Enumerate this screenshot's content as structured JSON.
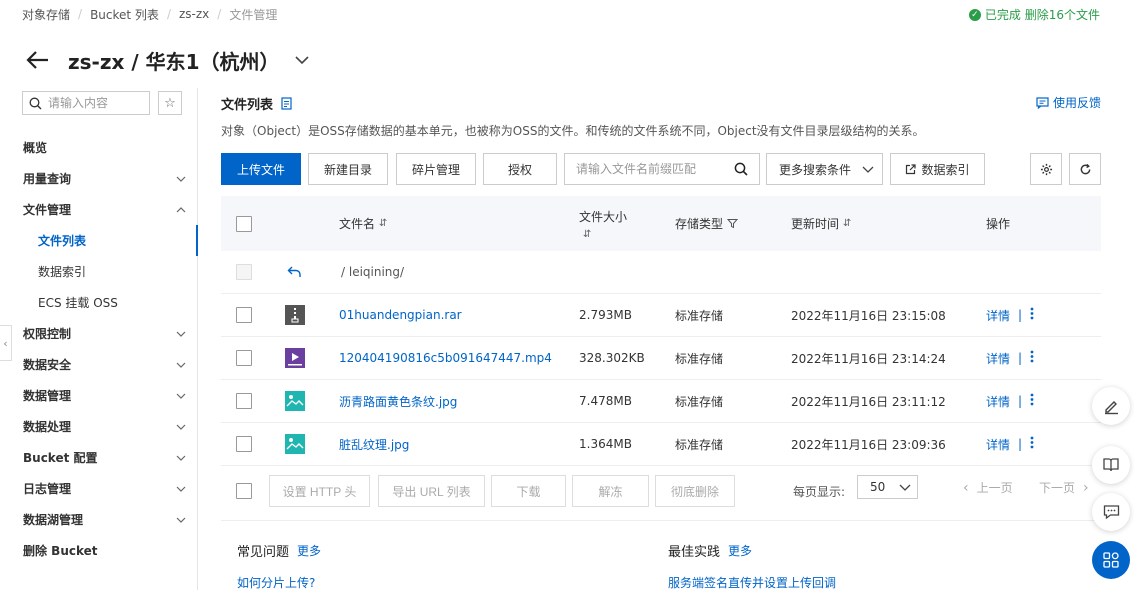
{
  "breadcrumb": [
    "对象存储",
    "Bucket 列表",
    "zs-zx",
    "文件管理"
  ],
  "status_text": "已完成 删除16个文件",
  "bucket_title": "zs-zx / 华东1（杭州）",
  "sidebar": {
    "search_placeholder": "请输入内容",
    "items": [
      {
        "label": "概览",
        "type": "item"
      },
      {
        "label": "用量查询",
        "type": "group",
        "chevron": "down"
      },
      {
        "label": "文件管理",
        "type": "group",
        "chevron": "up"
      },
      {
        "label": "文件列表",
        "type": "sub",
        "active": true
      },
      {
        "label": "数据索引",
        "type": "sub"
      },
      {
        "label": "ECS 挂载 OSS",
        "type": "sub"
      },
      {
        "label": "权限控制",
        "type": "group",
        "chevron": "down"
      },
      {
        "label": "数据安全",
        "type": "group",
        "chevron": "down"
      },
      {
        "label": "数据管理",
        "type": "group",
        "chevron": "down"
      },
      {
        "label": "数据处理",
        "type": "group",
        "chevron": "down"
      },
      {
        "label": "Bucket 配置",
        "type": "group",
        "chevron": "down"
      },
      {
        "label": "日志管理",
        "type": "group",
        "chevron": "down"
      },
      {
        "label": "数据湖管理",
        "type": "group",
        "chevron": "down"
      },
      {
        "label": "删除 Bucket",
        "type": "item"
      }
    ]
  },
  "main": {
    "section_title": "文件列表",
    "feedback": "使用反馈",
    "description": "对象（Object）是OSS存储数据的基本单元，也被称为OSS的文件。和传统的文件系统不同，Object没有文件目录层级结构的关系。",
    "toolbar": {
      "upload": "上传文件",
      "new_dir": "新建目录",
      "fragments": "碎片管理",
      "authorize": "授权",
      "search_placeholder": "请输入文件名前缀匹配",
      "more_search": "更多搜索条件",
      "data_index": "数据索引"
    },
    "table": {
      "headers": {
        "name": "文件名",
        "size": "文件大小",
        "storage": "存储类型",
        "updated": "更新时间",
        "actions": "操作"
      },
      "parent_path": "/  leiqining/",
      "rows": [
        {
          "name": "01huandengpian.rar",
          "size": "2.793MB",
          "storage": "标准存储",
          "updated": "2022年11月16日 23:15:08",
          "icon": "archive-icon"
        },
        {
          "name": "120404190816c5b091647447.mp4",
          "size": "328.302KB",
          "storage": "标准存储",
          "updated": "2022年11月16日 23:14:24",
          "icon": "video-icon"
        },
        {
          "name": "沥青路面黄色条纹.jpg",
          "size": "7.478MB",
          "storage": "标准存储",
          "updated": "2022年11月16日 23:11:12",
          "icon": "image-icon"
        },
        {
          "name": "脏乱纹理.jpg",
          "size": "1.364MB",
          "storage": "标准存储",
          "updated": "2022年11月16日 23:09:36",
          "icon": "image-icon"
        }
      ],
      "detail_label": "详情",
      "separator": "|"
    },
    "bulk_actions": [
      "设置 HTTP 头",
      "导出 URL 列表",
      "下载",
      "解冻",
      "彻底删除"
    ],
    "per_page_label": "每页显示:",
    "per_page_value": "50",
    "prev_page": "上一页",
    "next_page": "下一页",
    "faq": {
      "common_title": "常见问题",
      "best_title": "最佳实践",
      "more": "更多",
      "common_link": "如何分片上传?",
      "best_link": "服务端签名直传并设置上传回调"
    }
  },
  "colors": {
    "primary": "#0064c8",
    "success": "#2a9d4a",
    "header_bg": "#f5f7fa"
  }
}
